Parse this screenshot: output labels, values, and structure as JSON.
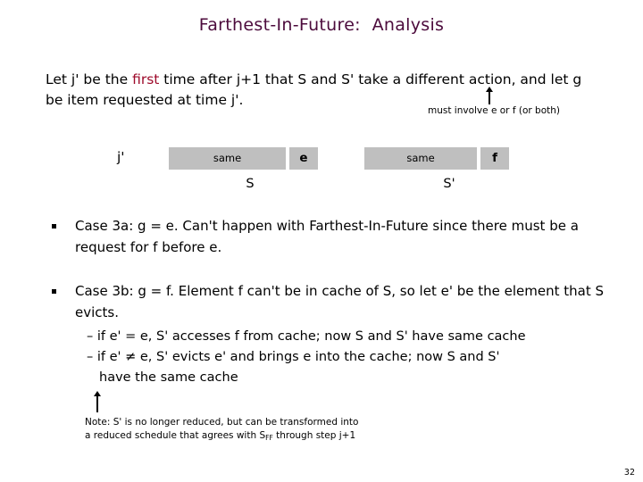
{
  "slide": {
    "title": "Farthest-In-Future:  Analysis",
    "page_number": "32",
    "title_color": "#4c0b3c",
    "highlight_color": "#9e0b2b",
    "box_fill_color": "#bfbfbf"
  },
  "intro": {
    "part1": "Let j' be the ",
    "highlight": "first",
    "part2": " time after j+1 that S and S' take a different action, and let g be item requested at time j'."
  },
  "annotation": {
    "arrow_icon": "up-arrow-icon",
    "text": "must involve e or f (or both)"
  },
  "diagram": {
    "time_label": "j'",
    "schedule_s": {
      "same_label": "same",
      "action_label": "e",
      "name": "S"
    },
    "schedule_sp": {
      "same_label": "same",
      "action_label": "f",
      "name": "S'"
    }
  },
  "bullets": [
    {
      "marker": "square-bullet-icon",
      "text": "Case 3a:  g = e.  Can't happen with Farthest-In-Future since there must be a request for f before e."
    },
    {
      "marker": "square-bullet-icon",
      "text": "Case 3b:  g = f.  Element f can't be in cache of S, so let e' be the element that S evicts."
    }
  ],
  "sub_bullets": [
    "–  if e' = e, S' accesses f from cache; now S and S' have same cache",
    "–  if e' ≠ e, S' evicts e' and brings e into the cache; now S and S'",
    "have the same cache"
  ],
  "note": {
    "arrow_icon": "up-arrow-icon",
    "line1": "Note:  S' is no longer reduced, but can be transformed into",
    "line2_before": "a reduced schedule that agrees with S",
    "line2_sub": "FF",
    "line2_after": " through step j+1"
  }
}
